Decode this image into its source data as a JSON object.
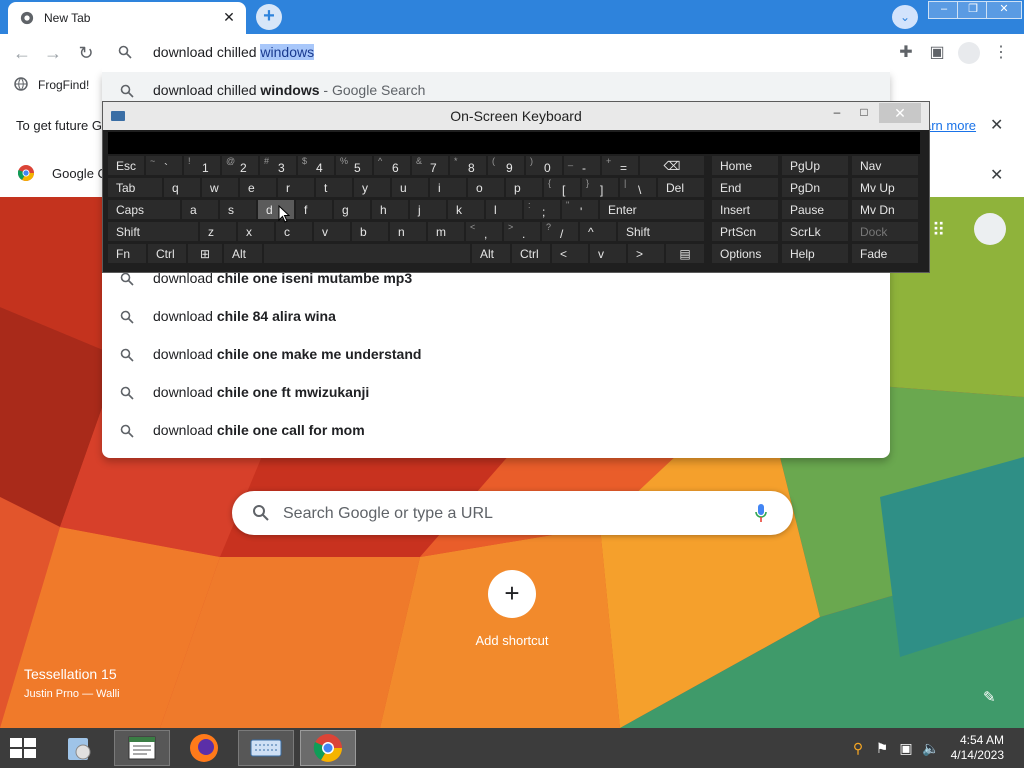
{
  "browser": {
    "tab_title": "New Tab",
    "bookmark": "FrogFind!",
    "omnibox": {
      "typed": "download chilled ",
      "selected": "windows"
    },
    "infobar": {
      "message": "To get future G",
      "link": "arn more"
    },
    "infobar2": {
      "label": "Google C"
    }
  },
  "suggestions": [
    {
      "prefix": "download chilled ",
      "bold": "windows",
      "suffix": " - Google Search"
    },
    {
      "prefix": "download ",
      "bold": "chile one iseni mutambe mp3",
      "suffix": ""
    },
    {
      "prefix": "download ",
      "bold": "chile 84 alira wina",
      "suffix": ""
    },
    {
      "prefix": "download ",
      "bold": "chile one make me understand",
      "suffix": ""
    },
    {
      "prefix": "download ",
      "bold": "chile one ft mwizukanji",
      "suffix": ""
    },
    {
      "prefix": "download ",
      "bold": "chile one call for mom",
      "suffix": ""
    }
  ],
  "osk": {
    "title": "On-Screen Keyboard",
    "rows": [
      [
        {
          "m": "Esc"
        },
        {
          "s": "~",
          "m": "`"
        },
        {
          "s": "!",
          "m": "1"
        },
        {
          "s": "@",
          "m": "2"
        },
        {
          "s": "#",
          "m": "3"
        },
        {
          "s": "$",
          "m": "4"
        },
        {
          "s": "%",
          "m": "5"
        },
        {
          "s": "^",
          "m": "6"
        },
        {
          "s": "&",
          "m": "7"
        },
        {
          "s": "*",
          "m": "8"
        },
        {
          "s": "(",
          "m": "9"
        },
        {
          "s": ")",
          "m": "0"
        },
        {
          "s": "_",
          "m": "-"
        },
        {
          "s": "+",
          "m": "="
        },
        {
          "m": "⌫"
        },
        {
          "m": "Home"
        },
        {
          "m": "PgUp"
        },
        {
          "m": "Nav"
        }
      ],
      [
        {
          "m": "Tab"
        },
        {
          "m": "q"
        },
        {
          "m": "w"
        },
        {
          "m": "e"
        },
        {
          "m": "r"
        },
        {
          "m": "t"
        },
        {
          "m": "y"
        },
        {
          "m": "u"
        },
        {
          "m": "i"
        },
        {
          "m": "o"
        },
        {
          "m": "p"
        },
        {
          "s": "{",
          "m": "["
        },
        {
          "s": "}",
          "m": "]"
        },
        {
          "s": "|",
          "m": "\\"
        },
        {
          "m": "Del"
        },
        {
          "m": "End"
        },
        {
          "m": "PgDn"
        },
        {
          "m": "Mv Up"
        }
      ],
      [
        {
          "m": "Caps"
        },
        {
          "m": "a"
        },
        {
          "m": "s"
        },
        {
          "m": "d"
        },
        {
          "m": "f"
        },
        {
          "m": "g"
        },
        {
          "m": "h"
        },
        {
          "m": "j"
        },
        {
          "m": "k"
        },
        {
          "m": "l"
        },
        {
          "s": ":",
          "m": ";"
        },
        {
          "s": "\"",
          "m": "'"
        },
        {
          "m": "Enter"
        },
        {
          "m": "Insert"
        },
        {
          "m": "Pause"
        },
        {
          "m": "Mv Dn"
        }
      ],
      [
        {
          "m": "Shift"
        },
        {
          "m": "z"
        },
        {
          "m": "x"
        },
        {
          "m": "c"
        },
        {
          "m": "v"
        },
        {
          "m": "b"
        },
        {
          "m": "n"
        },
        {
          "m": "m"
        },
        {
          "s": "<",
          "m": ","
        },
        {
          "s": ">",
          "m": "."
        },
        {
          "s": "?",
          "m": "/"
        },
        {
          "m": "^"
        },
        {
          "m": "Shift"
        },
        {
          "m": "PrtScn"
        },
        {
          "m": "ScrLk"
        },
        {
          "m": "Dock"
        }
      ],
      [
        {
          "m": "Fn"
        },
        {
          "m": "Ctrl"
        },
        {
          "m": "⊞"
        },
        {
          "m": "Alt"
        },
        {
          "m": ""
        },
        {
          "m": "Alt"
        },
        {
          "m": "Ctrl"
        },
        {
          "m": "<"
        },
        {
          "m": "v"
        },
        {
          "m": ">"
        },
        {
          "m": "▤"
        },
        {
          "m": "Options"
        },
        {
          "m": "Help"
        },
        {
          "m": "Fade"
        }
      ]
    ]
  },
  "newtab": {
    "search_placeholder": "Search Google or type a URL",
    "add_shortcut": "Add shortcut",
    "wallpaper_title": "Tessellation 15",
    "wallpaper_author": "Justin Prno — Walli"
  },
  "taskbar": {
    "time": "4:54 AM",
    "date": "4/14/2023"
  }
}
